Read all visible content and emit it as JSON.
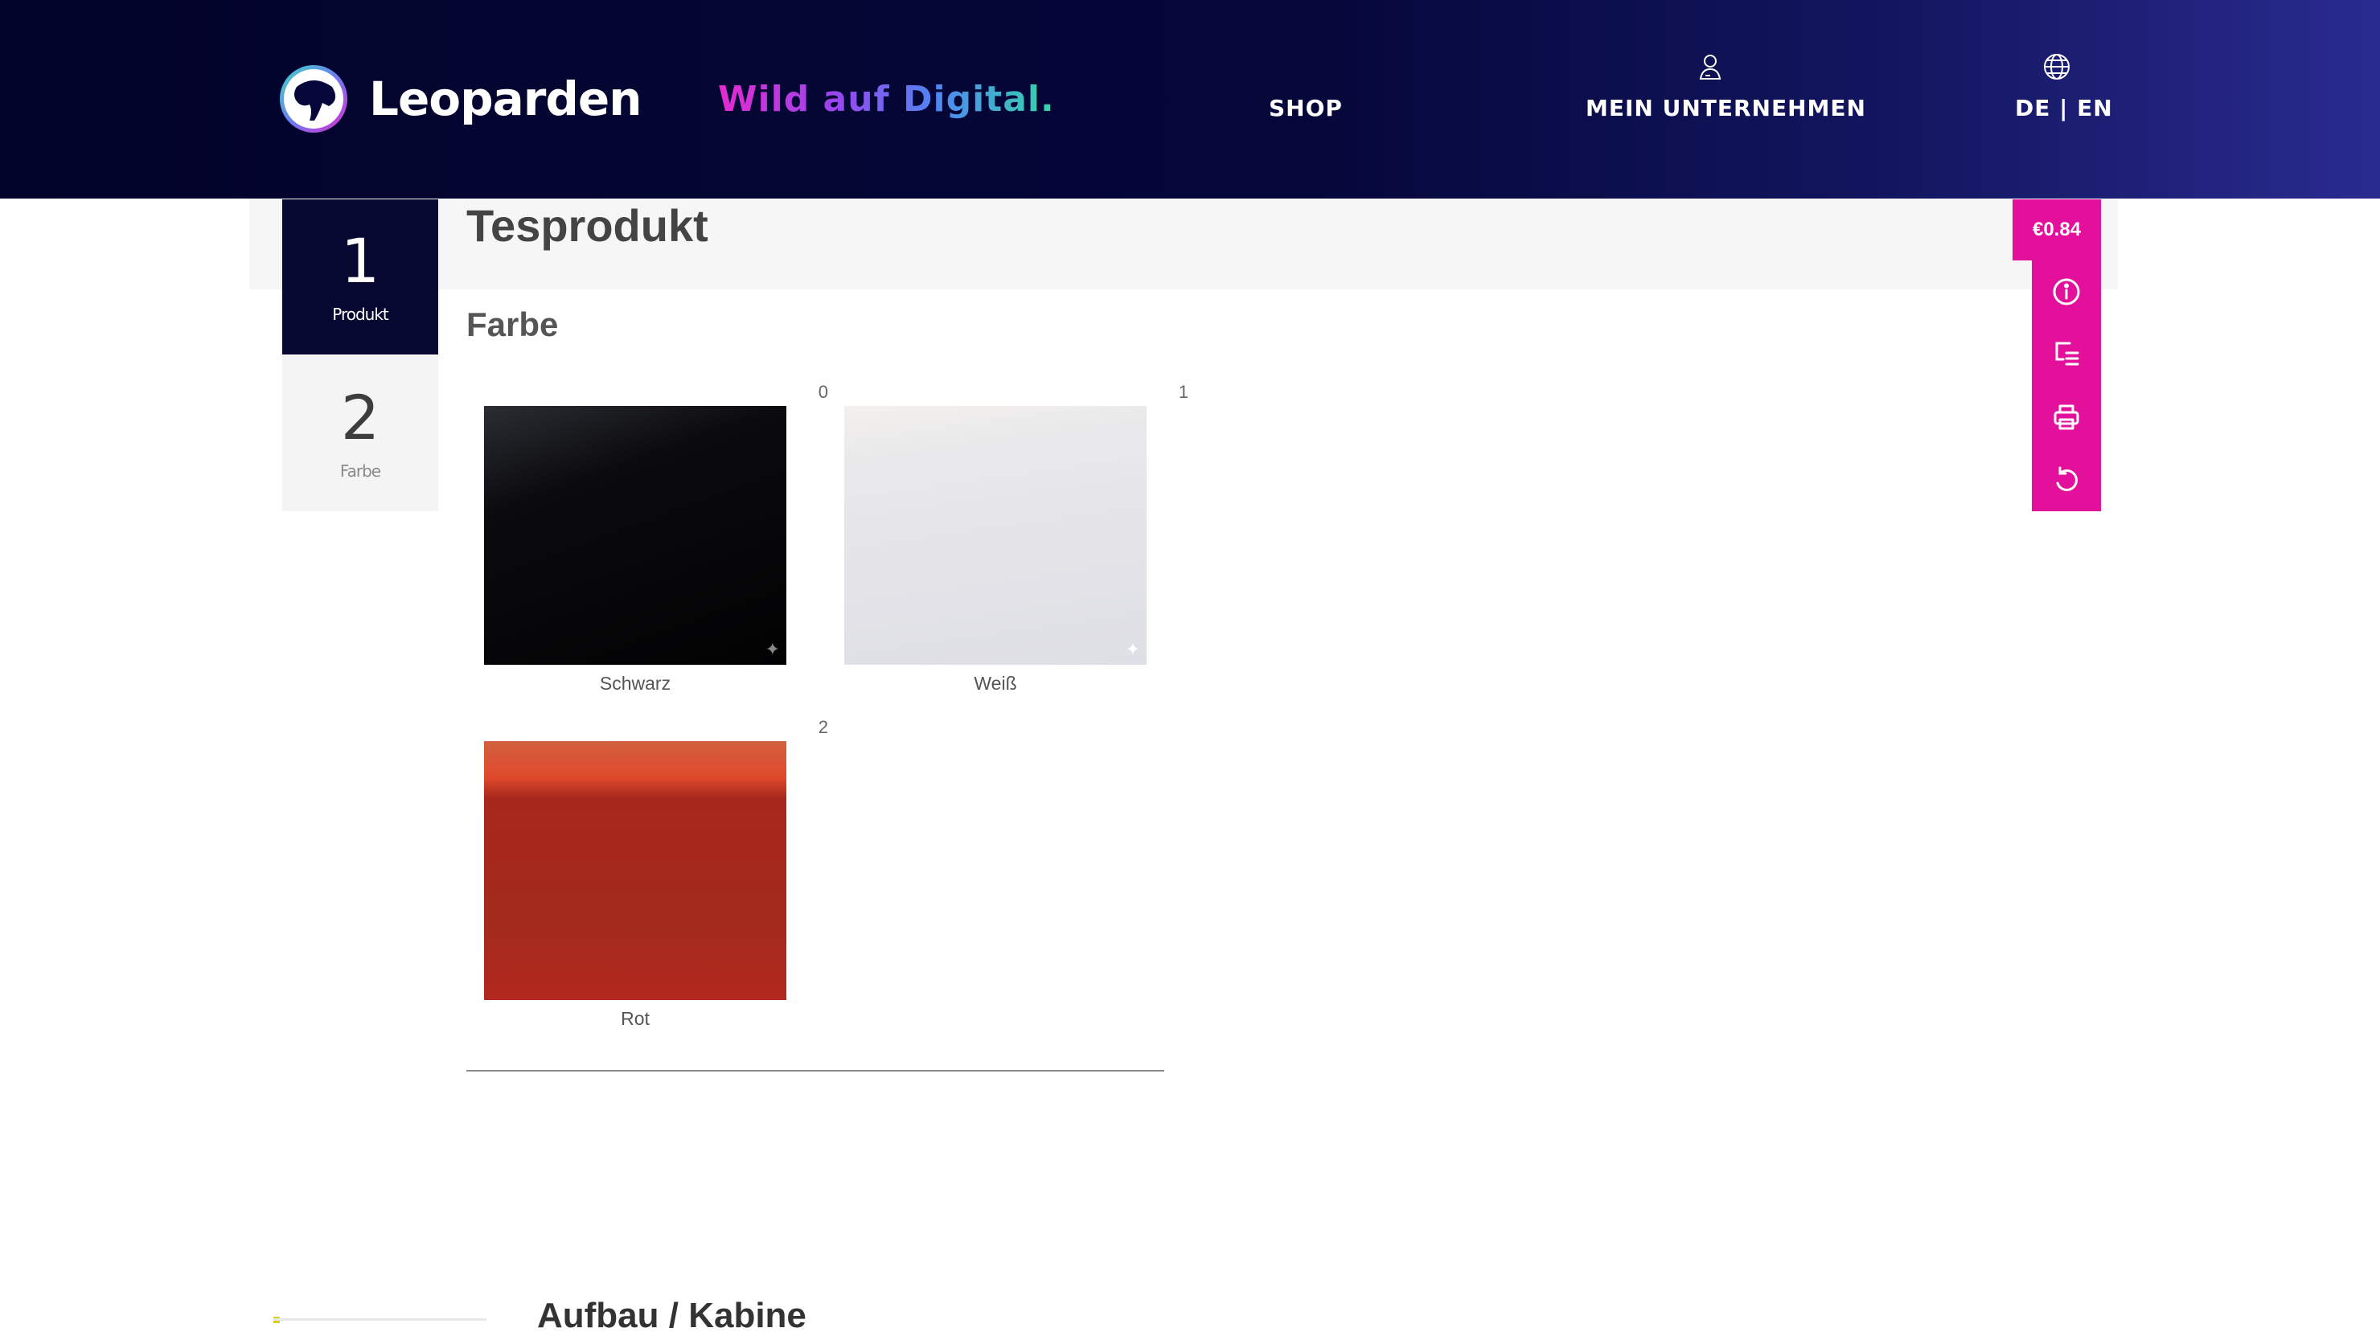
{
  "header": {
    "logo_text": "Leoparden",
    "tagline": "Wild auf Digital.",
    "nav": {
      "shop": "SHOP",
      "company": "MEIN UNTERNEHMEN",
      "language": "DE | EN"
    },
    "icons": [
      "leopard-logo-icon",
      "user-icon",
      "globe-icon"
    ]
  },
  "steps": [
    {
      "number": "1",
      "label": "Produkt",
      "active": true
    },
    {
      "number": "2",
      "label": "Farbe",
      "active": false
    }
  ],
  "product": {
    "title": "Tesprodukt",
    "section": "Farbe"
  },
  "colors": [
    {
      "index": "0",
      "name": "Schwarz",
      "color": "#050506"
    },
    {
      "index": "1",
      "name": "Weiß",
      "color": "#e2e2e8"
    },
    {
      "index": "2",
      "name": "Rot",
      "color": "#a8281d"
    }
  ],
  "toolbar": {
    "price": "€0.84",
    "accent": "#e3109b",
    "tools": [
      "info-icon",
      "summary-list-icon",
      "print-icon",
      "reset-icon"
    ]
  },
  "footer_partial_text": "Aufbau / Kabine"
}
